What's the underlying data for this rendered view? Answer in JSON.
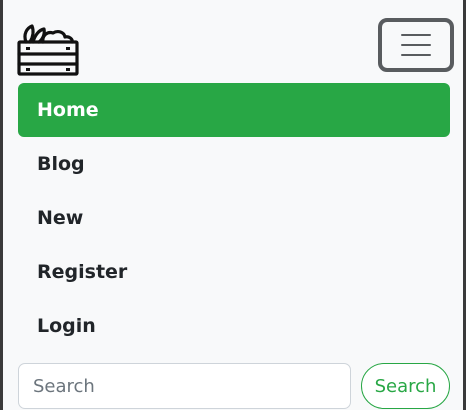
{
  "brand": {
    "logo_icon": "produce-crate-icon"
  },
  "navbar": {
    "toggler_icon": "hamburger-menu-icon",
    "items": [
      {
        "label": "Home",
        "active": true
      },
      {
        "label": "Blog",
        "active": false
      },
      {
        "label": "New",
        "active": false
      },
      {
        "label": "Register",
        "active": false
      },
      {
        "label": "Login",
        "active": false
      }
    ]
  },
  "search": {
    "placeholder": "Search",
    "value": "",
    "button_label": "Search"
  },
  "colors": {
    "accent": "#28a745",
    "navbar_bg": "#f8f9fa",
    "text": "#212529",
    "toggler_border": "#595c5f"
  }
}
